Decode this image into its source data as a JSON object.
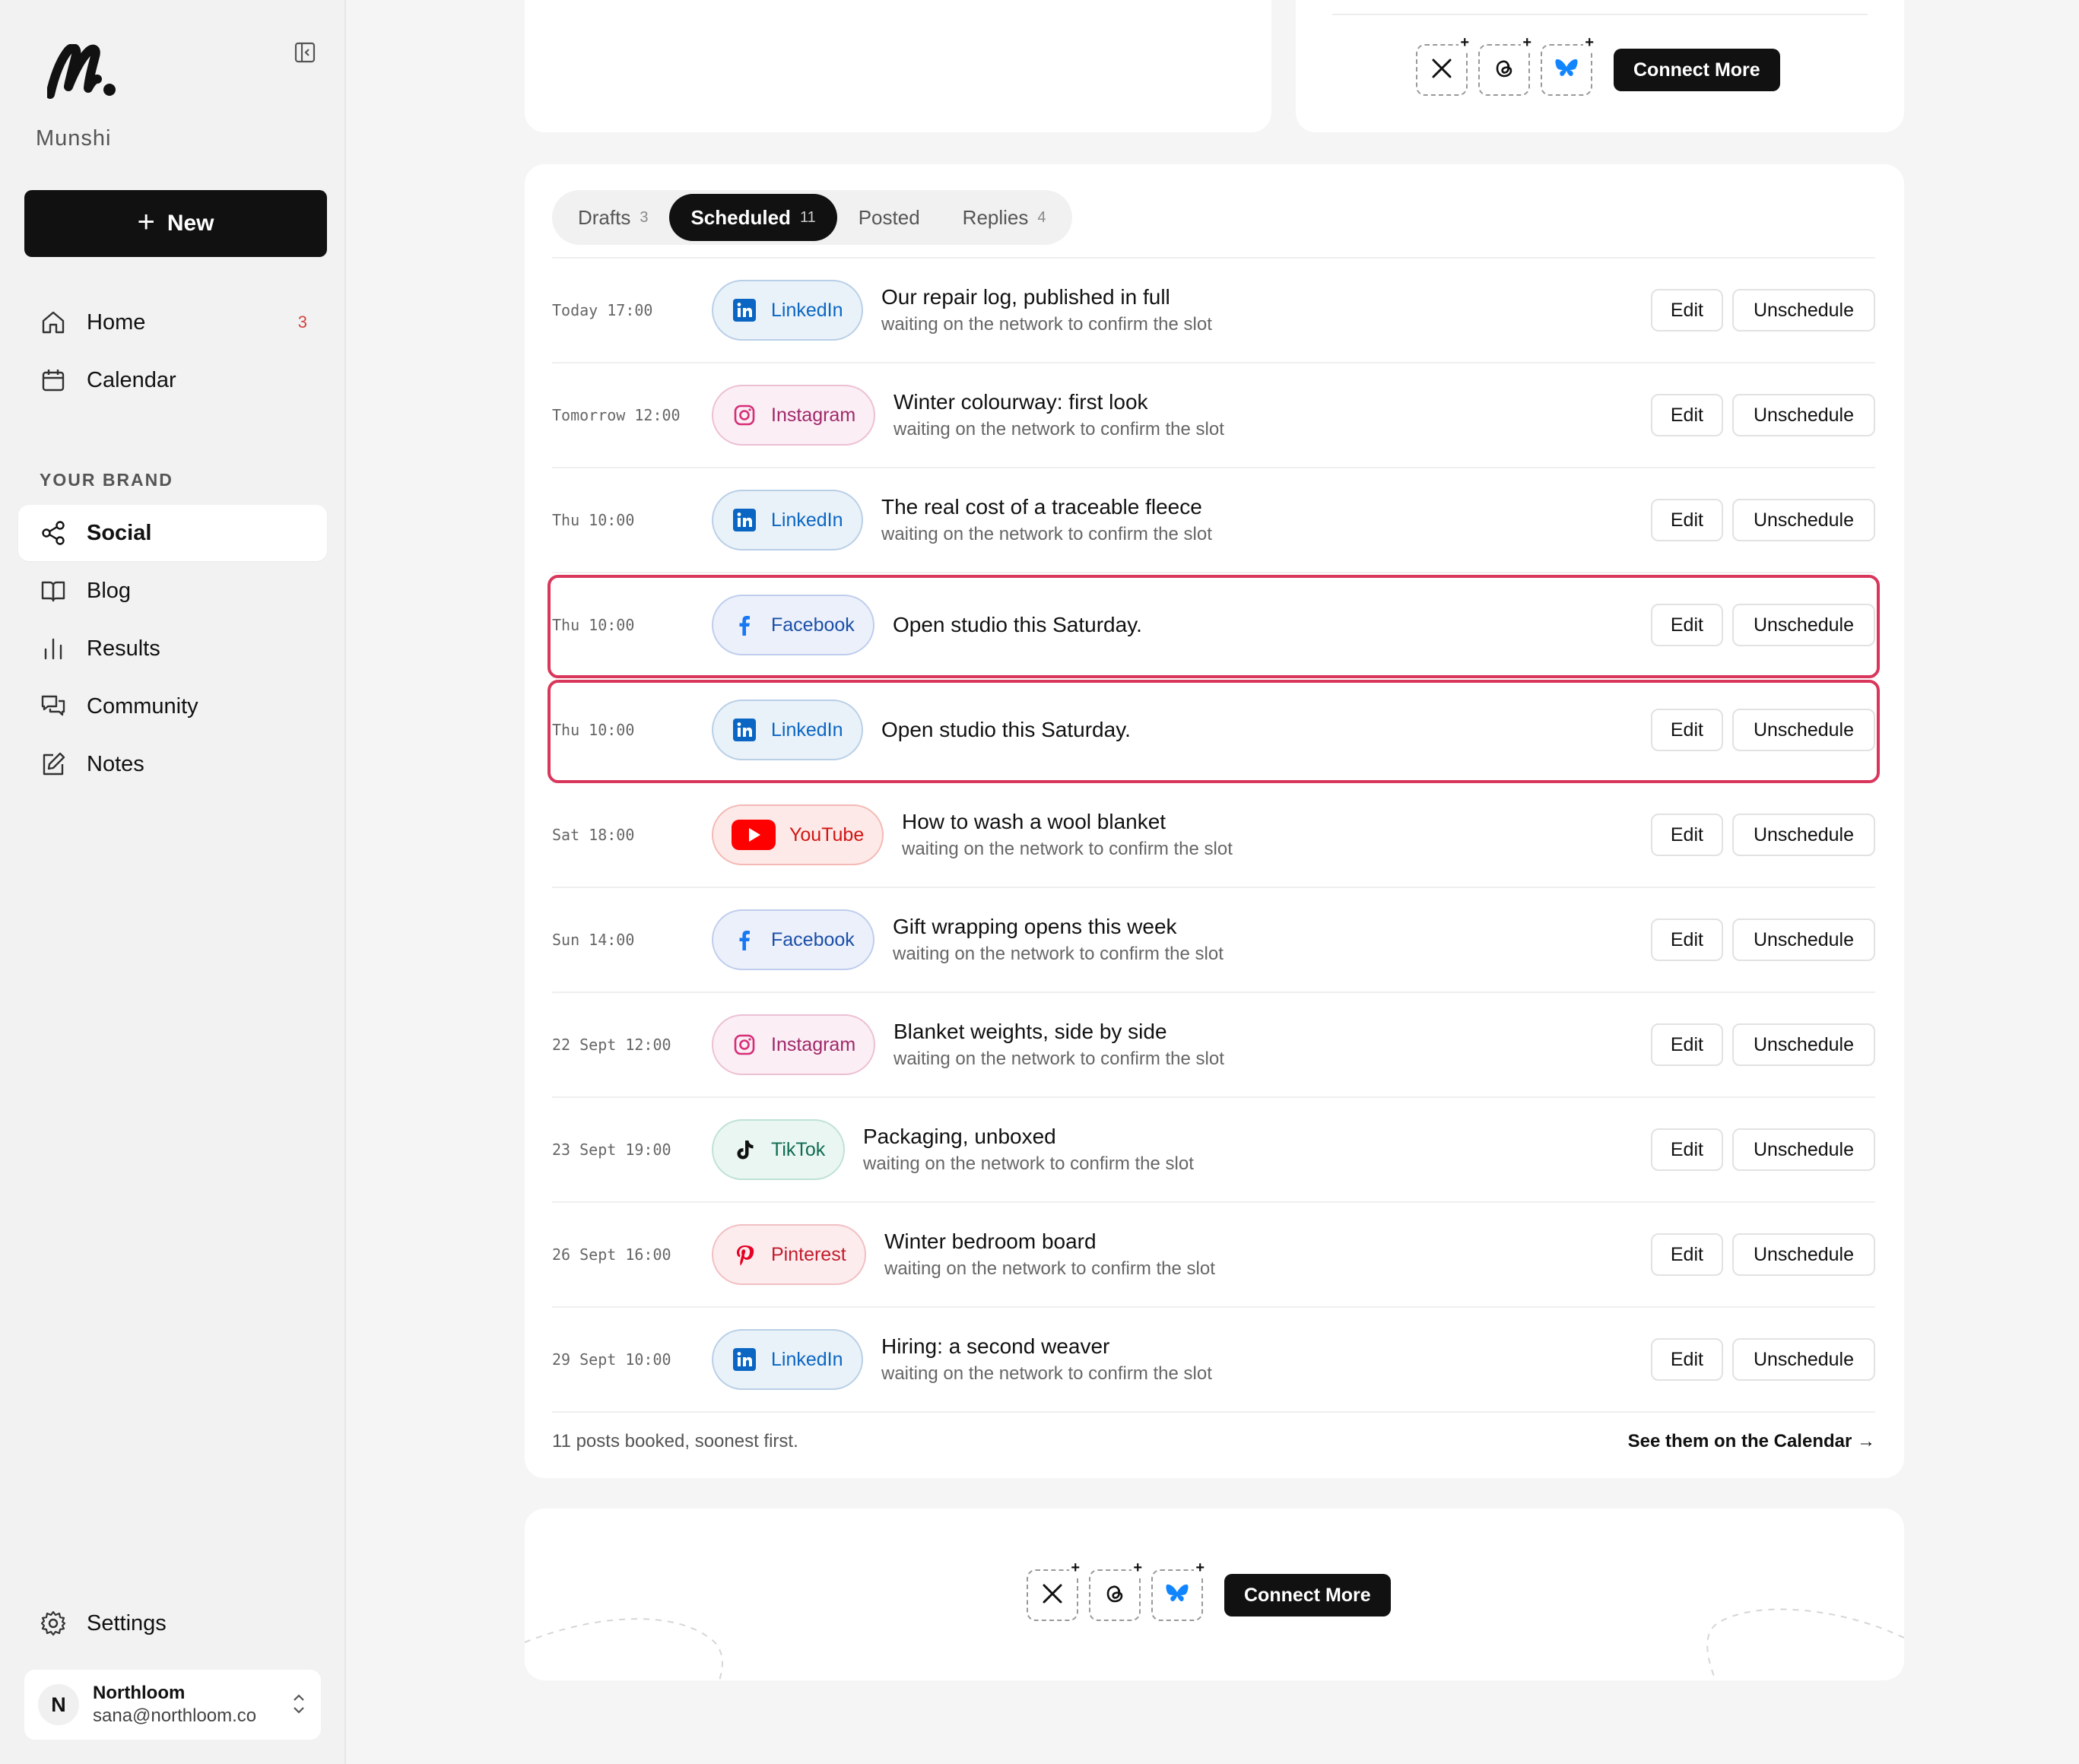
{
  "app": {
    "brand_name": "Munshi",
    "new_button_label": "New",
    "collapse_icon": "sidebar-collapse-icon"
  },
  "sidebar": {
    "primary": [
      {
        "label": "Home",
        "icon": "home-icon",
        "count": "3"
      },
      {
        "label": "Calendar",
        "icon": "calendar-icon",
        "count": ""
      }
    ],
    "section_label": "YOUR BRAND",
    "brand_items": [
      {
        "label": "Social",
        "icon": "share-icon",
        "active": true
      },
      {
        "label": "Blog",
        "icon": "book-icon"
      },
      {
        "label": "Results",
        "icon": "bar-chart-icon"
      },
      {
        "label": "Community",
        "icon": "chat-icon"
      },
      {
        "label": "Notes",
        "icon": "edit-icon"
      }
    ],
    "settings_label": "Settings",
    "user": {
      "initial": "N",
      "name": "Northloom",
      "email": "sana@northloom.co"
    }
  },
  "connect": {
    "networks": [
      "x",
      "threads",
      "bluesky"
    ],
    "button_label": "Connect More"
  },
  "tabs": [
    {
      "label": "Drafts",
      "count": "3",
      "active": false
    },
    {
      "label": "Scheduled",
      "count": "11",
      "active": true
    },
    {
      "label": "Posted",
      "count": "",
      "active": false
    },
    {
      "label": "Replies",
      "count": "4",
      "active": false
    }
  ],
  "actions": {
    "edit_label": "Edit",
    "unschedule_label": "Unschedule"
  },
  "posts": [
    {
      "time": "Today 17:00",
      "network": "LinkedIn",
      "network_key": "linkedin",
      "title": "Our repair log, published in full",
      "subtitle": "waiting on the network to confirm the slot",
      "highlighted": false
    },
    {
      "time": "Tomorrow 12:00",
      "network": "Instagram",
      "network_key": "instagram",
      "title": "Winter colourway: first look",
      "subtitle": "waiting on the network to confirm the slot",
      "highlighted": false
    },
    {
      "time": "Thu 10:00",
      "network": "LinkedIn",
      "network_key": "linkedin",
      "title": "The real cost of a traceable fleece",
      "subtitle": "waiting on the network to confirm the slot",
      "highlighted": false
    },
    {
      "time": "Thu 10:00",
      "network": "Facebook",
      "network_key": "facebook",
      "title": "Open studio this Saturday.",
      "subtitle": "",
      "highlighted": true
    },
    {
      "time": "Thu 10:00",
      "network": "LinkedIn",
      "network_key": "linkedin",
      "title": "Open studio this Saturday.",
      "subtitle": "",
      "highlighted": true
    },
    {
      "time": "Sat 18:00",
      "network": "YouTube",
      "network_key": "youtube",
      "title": "How to wash a wool blanket",
      "subtitle": "waiting on the network to confirm the slot",
      "highlighted": false
    },
    {
      "time": "Sun 14:00",
      "network": "Facebook",
      "network_key": "facebook",
      "title": "Gift wrapping opens this week",
      "subtitle": "waiting on the network to confirm the slot",
      "highlighted": false
    },
    {
      "time": "22 Sept 12:00",
      "network": "Instagram",
      "network_key": "instagram",
      "title": "Blanket weights, side by side",
      "subtitle": "waiting on the network to confirm the slot",
      "highlighted": false
    },
    {
      "time": "23 Sept 19:00",
      "network": "TikTok",
      "network_key": "tiktok",
      "title": "Packaging, unboxed",
      "subtitle": "waiting on the network to confirm the slot",
      "highlighted": false
    },
    {
      "time": "26 Sept 16:00",
      "network": "Pinterest",
      "network_key": "pinterest",
      "title": "Winter bedroom board",
      "subtitle": "waiting on the network to confirm the slot",
      "highlighted": false
    },
    {
      "time": "29 Sept 10:00",
      "network": "LinkedIn",
      "network_key": "linkedin",
      "title": "Hiring: a second weaver",
      "subtitle": "waiting on the network to confirm the slot",
      "highlighted": false
    }
  ],
  "footer": {
    "summary": "11 posts booked, soonest first.",
    "calendar_link": "See them on the Calendar →"
  },
  "colors": {
    "accent_dark": "#111111",
    "highlight_border": "#d9365b",
    "badge_count": "#d0453f"
  }
}
